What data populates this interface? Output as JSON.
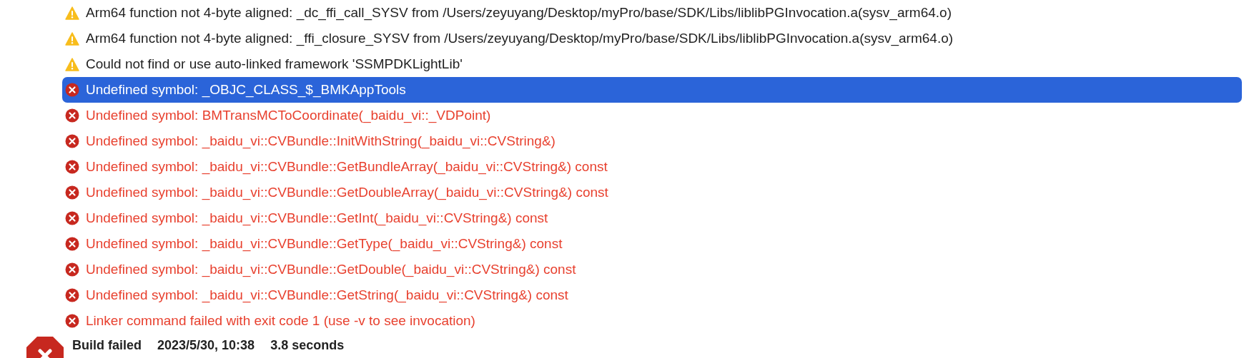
{
  "issues": [
    {
      "kind": "warning",
      "text": "Arm64 function not 4-byte aligned: _dc_ffi_call_SYSV from /Users/zeyuyang/Desktop/myPro/base/SDK/Libs/liblibPGInvocation.a(sysv_arm64.o)",
      "selected": false
    },
    {
      "kind": "warning",
      "text": "Arm64 function not 4-byte aligned: _ffi_closure_SYSV from /Users/zeyuyang/Desktop/myPro/base/SDK/Libs/liblibPGInvocation.a(sysv_arm64.o)",
      "selected": false
    },
    {
      "kind": "warning",
      "text": "Could not find or use auto-linked framework 'SSMPDKLightLib'",
      "selected": false
    },
    {
      "kind": "error",
      "text": "Undefined symbol: _OBJC_CLASS_$_BMKAppTools",
      "selected": true
    },
    {
      "kind": "error",
      "text": "Undefined symbol: BMTransMCToCoordinate(_baidu_vi::_VDPoint)",
      "selected": false
    },
    {
      "kind": "error",
      "text": "Undefined symbol: _baidu_vi::CVBundle::InitWithString(_baidu_vi::CVString&)",
      "selected": false
    },
    {
      "kind": "error",
      "text": "Undefined symbol: _baidu_vi::CVBundle::GetBundleArray(_baidu_vi::CVString&) const",
      "selected": false
    },
    {
      "kind": "error",
      "text": "Undefined symbol: _baidu_vi::CVBundle::GetDoubleArray(_baidu_vi::CVString&) const",
      "selected": false
    },
    {
      "kind": "error",
      "text": "Undefined symbol: _baidu_vi::CVBundle::GetInt(_baidu_vi::CVString&) const",
      "selected": false
    },
    {
      "kind": "error",
      "text": "Undefined symbol: _baidu_vi::CVBundle::GetType(_baidu_vi::CVString&) const",
      "selected": false
    },
    {
      "kind": "error",
      "text": "Undefined symbol: _baidu_vi::CVBundle::GetDouble(_baidu_vi::CVString&) const",
      "selected": false
    },
    {
      "kind": "error",
      "text": "Undefined symbol: _baidu_vi::CVBundle::GetString(_baidu_vi::CVString&) const",
      "selected": false
    },
    {
      "kind": "error",
      "text": "Linker command failed with exit code 1 (use -v to see invocation)",
      "selected": false
    }
  ],
  "build": {
    "status": "Build failed",
    "date": "2023/5/30, 10:38",
    "duration": "3.8 seconds"
  }
}
